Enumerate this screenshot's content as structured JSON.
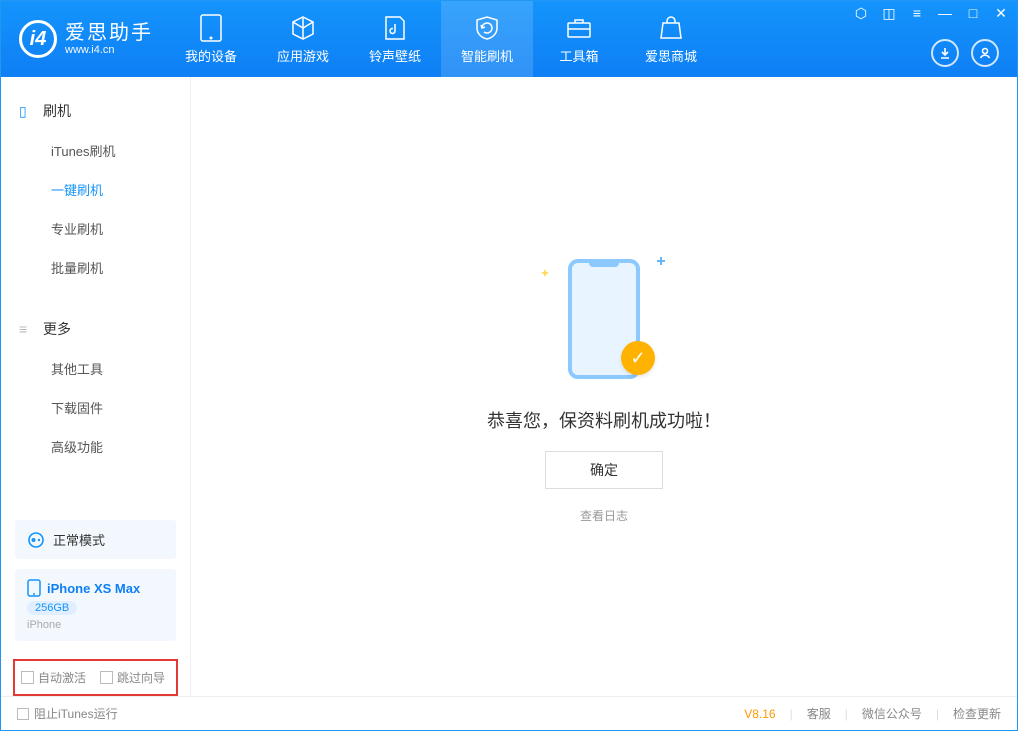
{
  "app": {
    "name_cn": "爱思助手",
    "name_en": "www.i4.cn",
    "logo_letter": "i4"
  },
  "nav": {
    "items": [
      {
        "label": "我的设备"
      },
      {
        "label": "应用游戏"
      },
      {
        "label": "铃声壁纸"
      },
      {
        "label": "智能刷机"
      },
      {
        "label": "工具箱"
      },
      {
        "label": "爱思商城"
      }
    ]
  },
  "sidebar": {
    "section1": {
      "title": "刷机",
      "items": [
        {
          "label": "iTunes刷机"
        },
        {
          "label": "一键刷机"
        },
        {
          "label": "专业刷机"
        },
        {
          "label": "批量刷机"
        }
      ]
    },
    "section2": {
      "title": "更多",
      "items": [
        {
          "label": "其他工具"
        },
        {
          "label": "下载固件"
        },
        {
          "label": "高级功能"
        }
      ]
    },
    "mode": "正常模式",
    "device": {
      "name": "iPhone XS Max",
      "capacity": "256GB",
      "type": "iPhone"
    },
    "options": {
      "auto_activate": "自动激活",
      "skip_guide": "跳过向导"
    }
  },
  "main": {
    "success_message": "恭喜您，保资料刷机成功啦！",
    "ok_button": "确定",
    "view_log": "查看日志"
  },
  "footer": {
    "block_itunes": "阻止iTunes运行",
    "version": "V8.16",
    "links": {
      "support": "客服",
      "wechat": "微信公众号",
      "update": "检查更新"
    }
  }
}
